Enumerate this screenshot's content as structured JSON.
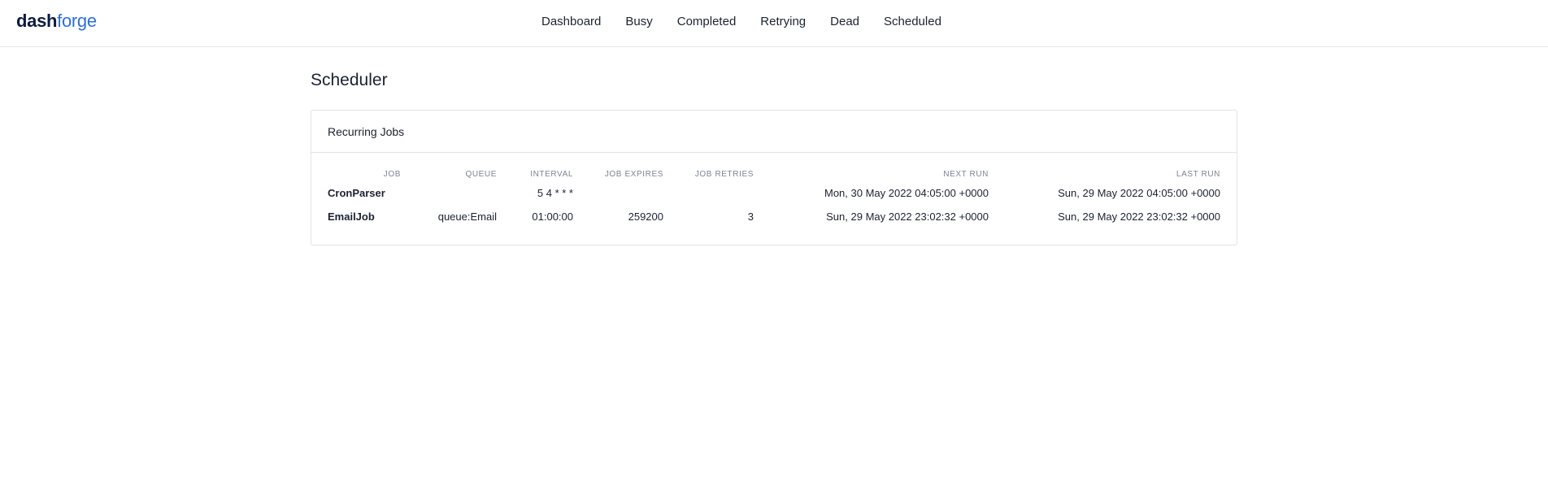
{
  "brand": {
    "part1": "dash",
    "part2": "forge"
  },
  "nav": [
    "Dashboard",
    "Busy",
    "Completed",
    "Retrying",
    "Dead",
    "Scheduled"
  ],
  "page": {
    "title": "Scheduler"
  },
  "card": {
    "title": "Recurring Jobs",
    "columns": [
      "JOB",
      "QUEUE",
      "INTERVAL",
      "JOB EXPIRES",
      "JOB RETRIES",
      "NEXT RUN",
      "LAST RUN"
    ],
    "rows": [
      [
        "CronParser",
        "",
        "5 4 * * *",
        "",
        "",
        "Mon, 30 May 2022 04:05:00 +0000",
        "Sun, 29 May 2022 04:05:00 +0000"
      ],
      [
        "EmailJob",
        "queue:Email",
        "01:00:00",
        "259200",
        "3",
        "Sun, 29 May 2022 23:02:32 +0000",
        "Sun, 29 May 2022 23:02:32 +0000"
      ]
    ]
  }
}
